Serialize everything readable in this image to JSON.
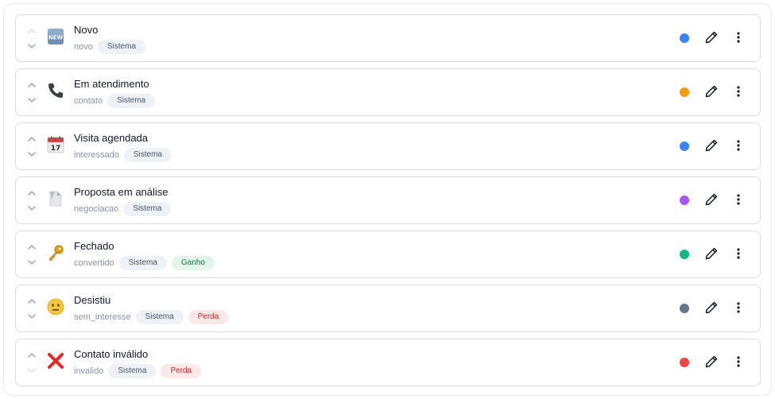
{
  "statuses": [
    {
      "title": "Novo",
      "key": "novo",
      "badges": [
        {
          "label": "Sistema",
          "kind": "sys"
        }
      ],
      "color": "#3b82f6",
      "icon": "new-button-icon"
    },
    {
      "title": "Em atendimento",
      "key": "contato",
      "badges": [
        {
          "label": "Sistema",
          "kind": "sys"
        }
      ],
      "color": "#f59e0b",
      "icon": "telephone-icon"
    },
    {
      "title": "Visita agendada",
      "key": "interessado",
      "badges": [
        {
          "label": "Sistema",
          "kind": "sys"
        }
      ],
      "color": "#3b82f6",
      "icon": "calendar-icon"
    },
    {
      "title": "Proposta em análise",
      "key": "negociacao",
      "badges": [
        {
          "label": "Sistema",
          "kind": "sys"
        }
      ],
      "color": "#a855f7",
      "icon": "document-icon"
    },
    {
      "title": "Fechado",
      "key": "convertido",
      "badges": [
        {
          "label": "Sistema",
          "kind": "sys"
        },
        {
          "label": "Ganho",
          "kind": "win"
        }
      ],
      "color": "#10b981",
      "icon": "key-icon"
    },
    {
      "title": "Desistiu",
      "key": "sem_interesse",
      "badges": [
        {
          "label": "Sistema",
          "kind": "sys"
        },
        {
          "label": "Perda",
          "kind": "loss"
        }
      ],
      "color": "#64748b",
      "icon": "neutral-face-icon"
    },
    {
      "title": "Contato inválido",
      "key": "invalido",
      "badges": [
        {
          "label": "Sistema",
          "kind": "sys"
        },
        {
          "label": "Perda",
          "kind": "loss"
        }
      ],
      "color": "#ef4444",
      "icon": "cross-mark-icon"
    }
  ]
}
